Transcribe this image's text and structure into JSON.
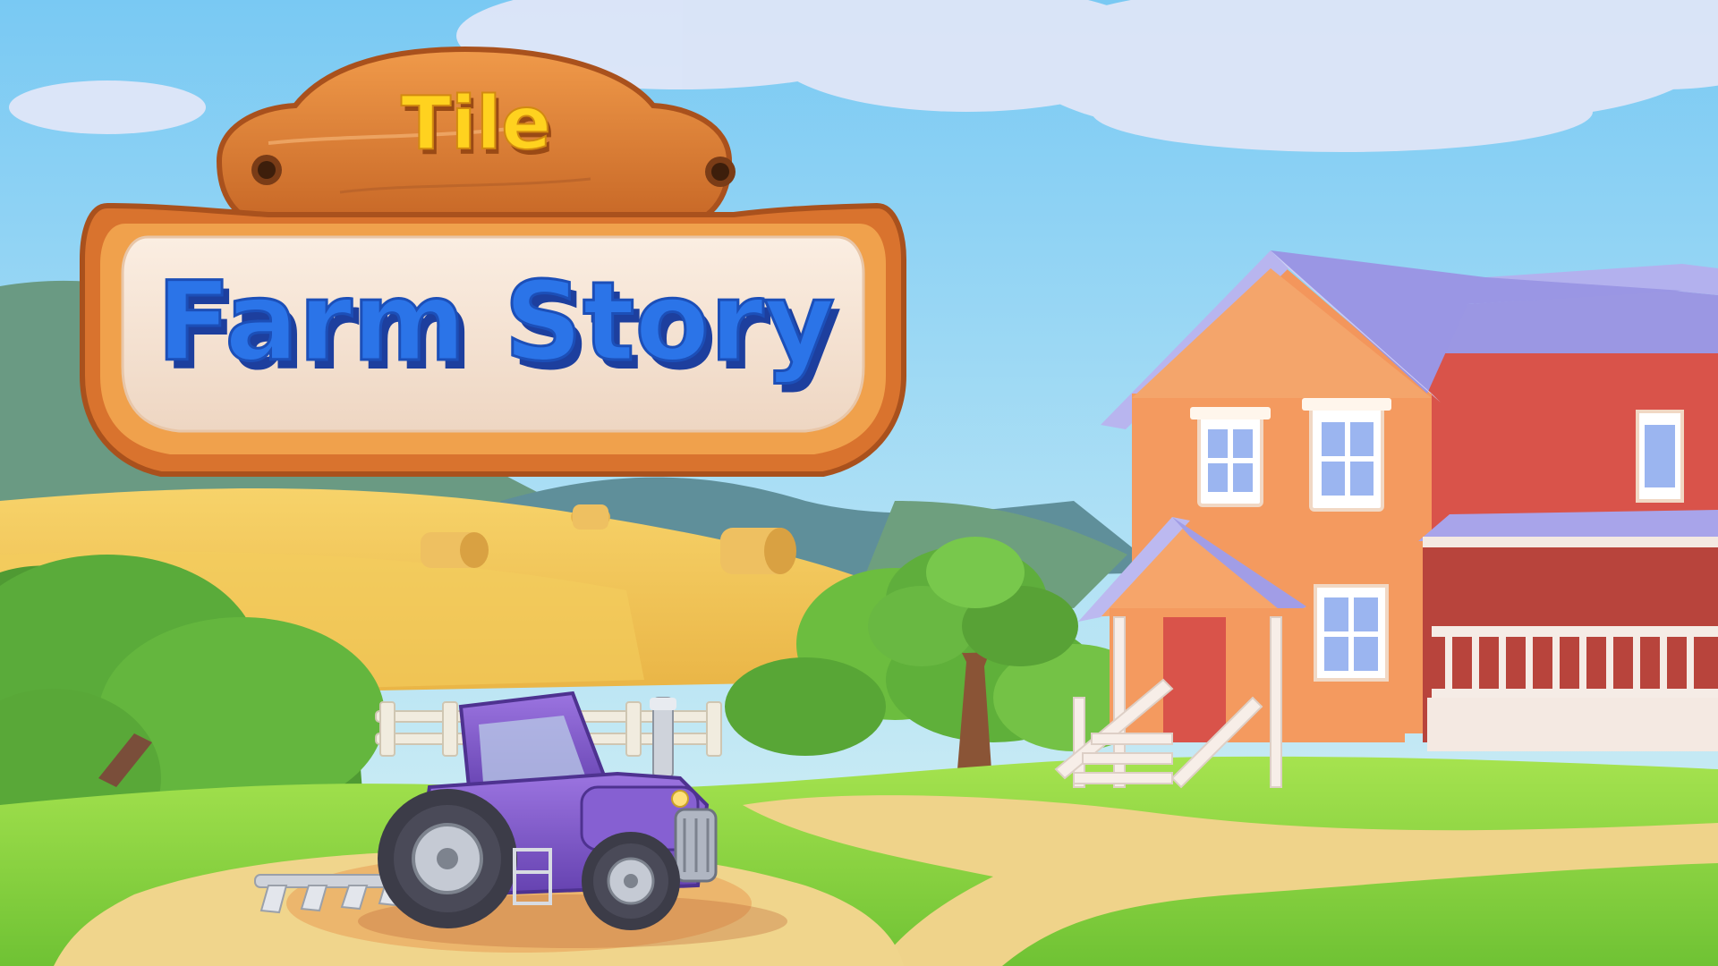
{
  "logo": {
    "top_word": "Tile",
    "main_words": "Farm Story"
  },
  "colors": {
    "sky_top": "#7fcdf5",
    "sky_bottom": "#c7ecf6",
    "logo_wood": "#e0883c",
    "logo_wood_dark": "#b5571f",
    "logo_panel": "#f6e5d6",
    "logo_title_blue": "#2b74e8",
    "logo_tile_yellow": "#ffd21f",
    "tractor_purple": "#7a52c7",
    "house_orange": "#f3965c",
    "house_red": "#d9534a",
    "roof_lavender": "#8f8fe0",
    "grass_green": "#8fd94a",
    "field_gold": "#f2c45a"
  },
  "scene": {
    "objects": [
      "logo-sign",
      "farmhouse",
      "tractor",
      "plow",
      "tree",
      "fence",
      "hay-bales",
      "hills",
      "clouds",
      "dirt-path"
    ]
  }
}
